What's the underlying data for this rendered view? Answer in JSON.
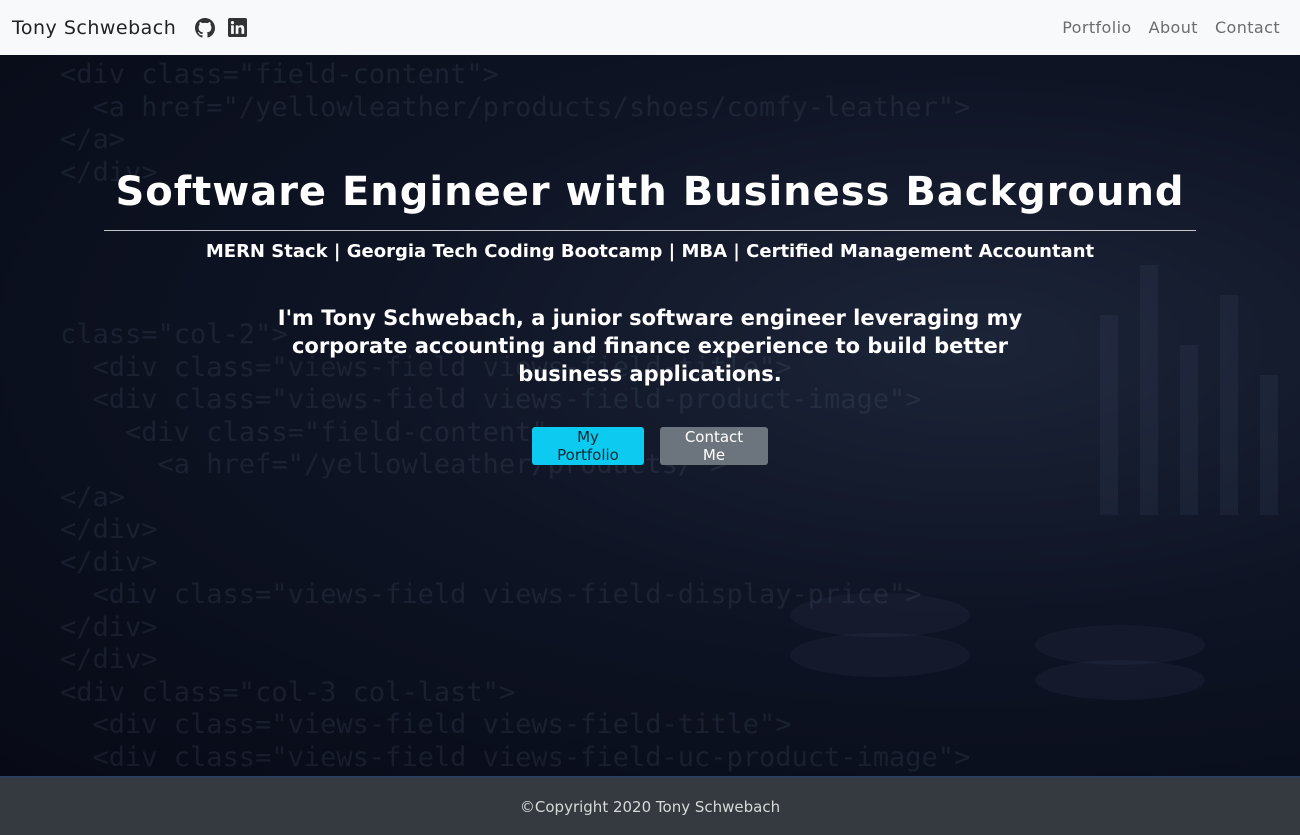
{
  "navbar": {
    "brand": "Tony Schwebach",
    "social": [
      {
        "icon": "github-icon"
      },
      {
        "icon": "linkedin-icon"
      }
    ],
    "links": [
      "Portfolio",
      "About",
      "Contact"
    ]
  },
  "hero": {
    "title": "Software Engineer with Business Background",
    "tagline": "MERN Stack | Georgia Tech Coding Bootcamp | MBA | Certified Management Accountant",
    "intro": "I'm Tony Schwebach, a junior software engineer leveraging my corporate accounting and finance experience to build better business applications.",
    "buttons": {
      "portfolio": "My Portfolio",
      "contact": "Contact Me"
    }
  },
  "footer": {
    "copyright": "©Copyright 2020 Tony Schwebach"
  },
  "colors": {
    "navbar_bg": "#f8f9fa",
    "hero_bg": "#0e1424",
    "portfolio_button": "#0dcaf0",
    "contact_button": "#6c757d",
    "footer_bg": "#343a40"
  }
}
